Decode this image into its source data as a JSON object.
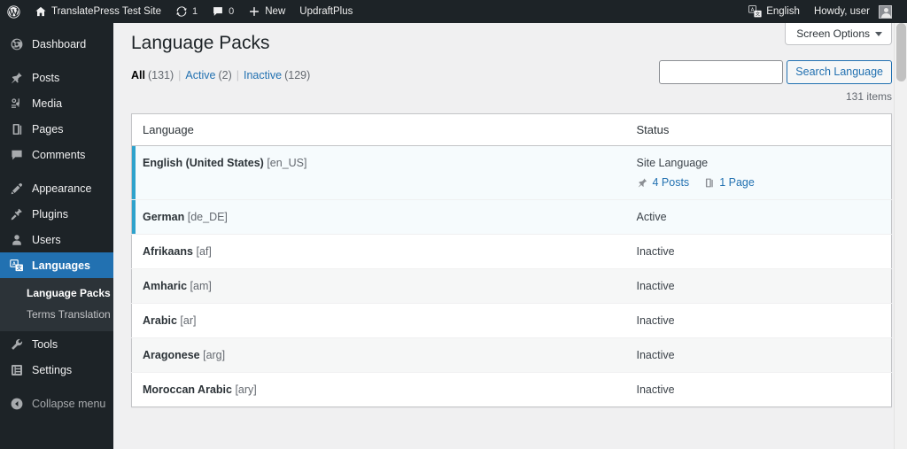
{
  "adminbar": {
    "wp_logo": "wordpress-logo-icon",
    "site_name": "TranslatePress Test Site",
    "updates_count": "1",
    "comments_count": "0",
    "new_label": "New",
    "updraft_label": "UpdraftPlus",
    "language_label": "English",
    "howdy": "Howdy, user"
  },
  "sidebar": {
    "items": [
      {
        "label": "Dashboard",
        "icon": "dashboard-icon",
        "name": "dashboard"
      },
      {
        "label": "Posts",
        "icon": "pin-icon",
        "name": "posts"
      },
      {
        "label": "Media",
        "icon": "media-icon",
        "name": "media"
      },
      {
        "label": "Pages",
        "icon": "pages-icon",
        "name": "pages"
      },
      {
        "label": "Comments",
        "icon": "comment-icon",
        "name": "comments"
      },
      {
        "label": "Appearance",
        "icon": "brush-icon",
        "name": "appearance"
      },
      {
        "label": "Plugins",
        "icon": "plugin-icon",
        "name": "plugins"
      },
      {
        "label": "Users",
        "icon": "user-icon",
        "name": "users"
      },
      {
        "label": "Languages",
        "icon": "translate-icon",
        "name": "languages"
      },
      {
        "label": "Tools",
        "icon": "wrench-icon",
        "name": "tools"
      },
      {
        "label": "Settings",
        "icon": "settings-icon",
        "name": "settings"
      }
    ],
    "submenu": [
      {
        "label": "Language Packs",
        "name": "language-packs"
      },
      {
        "label": "Terms Translation",
        "name": "terms-translation"
      }
    ],
    "collapse_label": "Collapse menu"
  },
  "screen_options": {
    "label": "Screen Options"
  },
  "page": {
    "title": "Language Packs",
    "items_count": "131 items"
  },
  "filters": [
    {
      "label": "All",
      "count": "(131)",
      "current": true
    },
    {
      "label": "Active",
      "count": "(2)",
      "current": false
    },
    {
      "label": "Inactive",
      "count": "(129)",
      "current": false
    }
  ],
  "search": {
    "value": "",
    "placeholder": "",
    "button_label": "Search Language"
  },
  "table": {
    "columns": [
      "Language",
      "Status"
    ],
    "rows": [
      {
        "language": "English (United States)",
        "code": "[en_US]",
        "status": "Site Language",
        "active": true,
        "counts": [
          {
            "label": "4 Posts",
            "icon": "pin-icon"
          },
          {
            "label": "1 Page",
            "icon": "pages-icon"
          }
        ]
      },
      {
        "language": "German",
        "code": "[de_DE]",
        "status": "Active",
        "active": true,
        "counts": []
      },
      {
        "language": "Afrikaans",
        "code": "[af]",
        "status": "Inactive",
        "active": false,
        "counts": []
      },
      {
        "language": "Amharic",
        "code": "[am]",
        "status": "Inactive",
        "active": false,
        "counts": []
      },
      {
        "language": "Arabic",
        "code": "[ar]",
        "status": "Inactive",
        "active": false,
        "counts": []
      },
      {
        "language": "Aragonese",
        "code": "[arg]",
        "status": "Inactive",
        "active": false,
        "counts": []
      },
      {
        "language": "Moroccan Arabic",
        "code": "[ary]",
        "status": "Inactive",
        "active": false,
        "counts": []
      }
    ]
  },
  "colors": {
    "admin_bar": "#1d2327",
    "sidebar": "#1d2327",
    "accent": "#2271b1",
    "active_row_bar": "#2ea2cc",
    "link": "#2271b1",
    "content_bg": "#f0f0f1"
  }
}
